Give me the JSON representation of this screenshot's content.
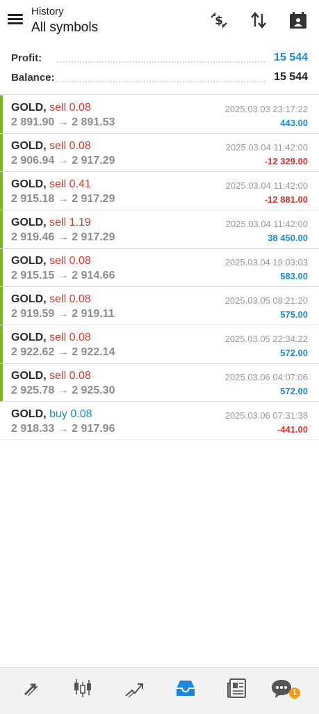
{
  "header": {
    "subtitle": "History",
    "title": "All symbols",
    "icons": [
      "menu-icon",
      "currency-exchange-icon",
      "sort-icon",
      "calendar-icon"
    ]
  },
  "summary": {
    "profit_label": "Profit:",
    "profit_value": "15 544",
    "balance_label": "Balance:",
    "balance_value": "15 544"
  },
  "colors": {
    "sell": "#d9342b",
    "buy": "#1a87e0",
    "positive": "#1a87e0",
    "negative": "#d9342b",
    "bar": "#7cb518",
    "accent": "#1a87e0"
  },
  "trades": [
    {
      "symbol": "GOLD,",
      "side": "sell",
      "volume": "0.08",
      "open": "2 891.90",
      "close": "2 891.53",
      "time": "2025.03.03 23:17:22",
      "profit": "443.00",
      "profit_positive": true,
      "bar": true
    },
    {
      "symbol": "GOLD,",
      "side": "sell",
      "volume": "0.08",
      "open": "2 906.94",
      "close": "2 917.29",
      "time": "2025.03.04 11:42:00",
      "profit": "-12 329.00",
      "profit_positive": false,
      "bar": true
    },
    {
      "symbol": "GOLD,",
      "side": "sell",
      "volume": "0.41",
      "open": "2 915.18",
      "close": "2 917.29",
      "time": "2025.03.04 11:42:00",
      "profit": "-12 881.00",
      "profit_positive": false,
      "bar": true
    },
    {
      "symbol": "GOLD,",
      "side": "sell",
      "volume": "1.19",
      "open": "2 919.46",
      "close": "2 917.29",
      "time": "2025.03.04 11:42:00",
      "profit": "38 450.00",
      "profit_positive": true,
      "bar": true
    },
    {
      "symbol": "GOLD,",
      "side": "sell",
      "volume": "0.08",
      "open": "2 915.15",
      "close": "2 914.66",
      "time": "2025.03.04 19:03:03",
      "profit": "583.00",
      "profit_positive": true,
      "bar": true
    },
    {
      "symbol": "GOLD,",
      "side": "sell",
      "volume": "0.08",
      "open": "2 919.59",
      "close": "2 919.11",
      "time": "2025.03.05 08:21:20",
      "profit": "575.00",
      "profit_positive": true,
      "bar": true
    },
    {
      "symbol": "GOLD,",
      "side": "sell",
      "volume": "0.08",
      "open": "2 922.62",
      "close": "2 922.14",
      "time": "2025.03.05 22:34:22",
      "profit": "572.00",
      "profit_positive": true,
      "bar": true
    },
    {
      "symbol": "GOLD,",
      "side": "sell",
      "volume": "0.08",
      "open": "2 925.78",
      "close": "2 925.30",
      "time": "2025.03.06 04:07:06",
      "profit": "572.00",
      "profit_positive": true,
      "bar": true
    },
    {
      "symbol": "GOLD,",
      "side": "buy",
      "volume": "0.08",
      "open": "2 918.33",
      "close": "2 917.96",
      "time": "2025.03.06 07:31:38",
      "profit": "-441.00",
      "profit_positive": false,
      "bar": false
    }
  ],
  "arrow": "→",
  "bottom_nav": {
    "items": [
      "quotes-icon",
      "chart-icon",
      "trade-icon",
      "history-icon",
      "news-icon",
      "chat-icon"
    ],
    "active": "history-icon",
    "chat_badge": "1"
  }
}
